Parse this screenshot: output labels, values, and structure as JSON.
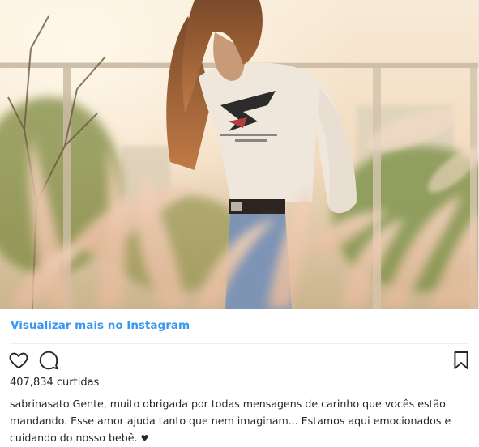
{
  "post": {
    "image_alt": "Photo of a woman in a cream sweater among pampas grass at sunset",
    "view_more_label": "Visualizar mais no Instagram",
    "likes_text": "407,834 curtidas",
    "caption": {
      "username": "sabrinasato",
      "text": "Gente, muito obrigada por todas mensagens de carinho que vocês estão mandando. Esse amor ajuda tanto que nem imaginam... Estamos aqui emocionados e cuidando do nosso bebê.",
      "emoji": "♥"
    }
  },
  "icons": {
    "like": "heart-outline-icon",
    "comment": "comment-bubble-icon",
    "save": "bookmark-icon"
  },
  "colors": {
    "link": "#3897f0",
    "text": "#262626",
    "divider": "#efefef"
  }
}
